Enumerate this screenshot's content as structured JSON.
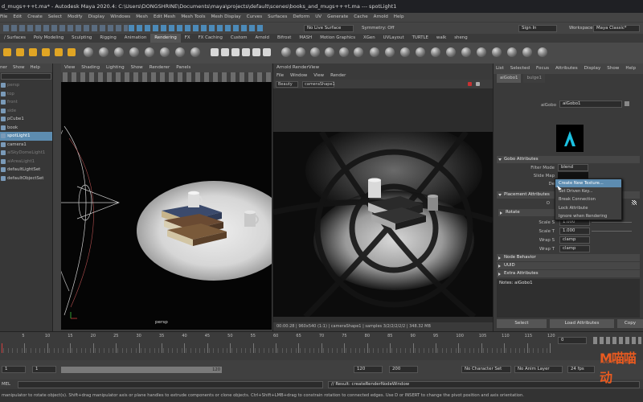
{
  "title": "d_mugs+++t.ma* - Autodesk Maya 2020.4: C:\\Users\\DONGSHRINE\\Documents\\maya\\projects\\default\\scenes\\books_and_mugs+++t.ma --- spotLight1",
  "menu": [
    "File",
    "Edit",
    "Create",
    "Select",
    "Modify",
    "Display",
    "Windows",
    "Mesh",
    "Edit Mesh",
    "Mesh Tools",
    "Mesh Display",
    "Curves",
    "Surfaces",
    "Deform",
    "UV",
    "Generate",
    "Cache",
    "Arnold",
    "Help"
  ],
  "workspace_label": "Workspace :",
  "workspace_value": "Maya Classic*",
  "live_surface": "No Live Surface",
  "symmetry": "Symmetry: Off",
  "sign_in": "Sign In",
  "shelf_tabs": [
    {
      "label": "/ Surfaces",
      "active": false
    },
    {
      "label": "Poly Modeling",
      "active": false
    },
    {
      "label": "Sculpting",
      "active": false
    },
    {
      "label": "Rigging",
      "active": false
    },
    {
      "label": "Animation",
      "active": false
    },
    {
      "label": "Rendering",
      "active": true
    },
    {
      "label": "FX",
      "active": false
    },
    {
      "label": "FX Caching",
      "active": false
    },
    {
      "label": "Custom",
      "active": false
    },
    {
      "label": "Arnold",
      "active": false
    },
    {
      "label": "Bifrost",
      "active": false
    },
    {
      "label": "MASH",
      "active": false
    },
    {
      "label": "Motion Graphics",
      "active": false
    },
    {
      "label": "XGen",
      "active": false
    },
    {
      "label": "UVLayout",
      "active": false
    },
    {
      "label": "TURTLE",
      "active": false
    },
    {
      "label": "walk",
      "active": false
    },
    {
      "label": "sheng",
      "active": false
    }
  ],
  "outliner": {
    "menu": [
      "ner",
      "Show",
      "Help"
    ],
    "items": [
      {
        "label": "persp",
        "dim": true,
        "sel": false
      },
      {
        "label": "top",
        "dim": true,
        "sel": false
      },
      {
        "label": "front",
        "dim": true,
        "sel": false
      },
      {
        "label": "side",
        "dim": true,
        "sel": false
      },
      {
        "label": "pCube1",
        "dim": false,
        "sel": false
      },
      {
        "label": "book",
        "dim": false,
        "sel": false
      },
      {
        "label": "spotLight1",
        "dim": false,
        "sel": true
      },
      {
        "label": "camera1",
        "dim": false,
        "sel": false
      },
      {
        "label": "aiSkyDomeLight1",
        "dim": true,
        "sel": false
      },
      {
        "label": "aiAreaLight1",
        "dim": true,
        "sel": false
      },
      {
        "label": "defaultLightSet",
        "dim": false,
        "sel": false
      },
      {
        "label": "defaultObjectSet",
        "dim": false,
        "sel": false
      }
    ]
  },
  "viewport": {
    "menu": [
      "View",
      "Shading",
      "Lighting",
      "Show",
      "Renderer",
      "Panels"
    ],
    "camera_label": "persp"
  },
  "render_view": {
    "title": "Arnold RenderView",
    "menu": [
      "File",
      "Window",
      "View",
      "Render"
    ],
    "beauty": "Beauty",
    "camera": "cameraShape1",
    "status": "00:00:28 | 960x540 (1:1) | cameraShape1 | samples 3/2/2/2/2/2 | 348.32 MB"
  },
  "attr_editor": {
    "tabs": [
      "List",
      "Selected",
      "Focus",
      "Attributes",
      "Display",
      "Show",
      "Help"
    ],
    "node_tabs": [
      "aiGobo1",
      "bulge1"
    ],
    "node_label": "aiGobo",
    "node_name": "aiGobo1",
    "sections": {
      "gobo": "Gobo Attributes",
      "placement": "Placement Attributes",
      "rotate": "Rotate",
      "node_behavior": "Node Behavior",
      "uuid": "UUID",
      "extra": "Extra Attributes"
    },
    "filter_mode_label": "Filter Mode",
    "filter_mode": "blend",
    "slide_map_label": "Slide Map",
    "density_label": "De",
    "offset_label": "O",
    "scale_s_label": "Scale S",
    "scale_s": "1.000",
    "scale_t_label": "Scale T",
    "scale_t": "1.000",
    "wrap_s_label": "Wrap S",
    "wrap_s": "clamp",
    "wrap_t_label": "Wrap T",
    "wrap_t": "clamp",
    "notes": "Notes: aiGobo1",
    "select_button": "Select",
    "load_button": "Load Attributes",
    "copy_button": "Copy"
  },
  "context_menu": [
    "Create New Texture...",
    "Set Driven Key...",
    "Break Connection",
    "Lock Attribute",
    "Ignore when Rendering"
  ],
  "timeline": {
    "ticks": [
      "5",
      "10",
      "15",
      "20",
      "25",
      "30",
      "35",
      "40",
      "45",
      "50",
      "55",
      "60",
      "65",
      "70",
      "75",
      "80",
      "85",
      "90",
      "95",
      "100",
      "105",
      "110",
      "115",
      "120"
    ],
    "current_frame": "0"
  },
  "range": {
    "start": "1",
    "inner_start": "1",
    "slider_end": "120",
    "end": "120",
    "max": "200",
    "character_set": "No Character Set",
    "anim_layer": "No Anim Layer",
    "fps": "24 fps"
  },
  "command": {
    "lang": "MEL",
    "result": "// Result: createRenderNodeWindow"
  },
  "help_line": "manipulator to rotate object(s). Shift+drag manipulator axis or plane handles to extrude components or clone objects. Ctrl+Shift+LMB+drag to constrain rotation to connected edges. Use D or INSERT to change the pivot position and axis orientation.",
  "watermark": "M喵喵动",
  "watermark_sub": "MIAO MIAO ANIMA",
  "colors": {
    "accent": "#5d8cb0",
    "shelf_icon": "#e0a524",
    "watermark": "#e85a20"
  }
}
